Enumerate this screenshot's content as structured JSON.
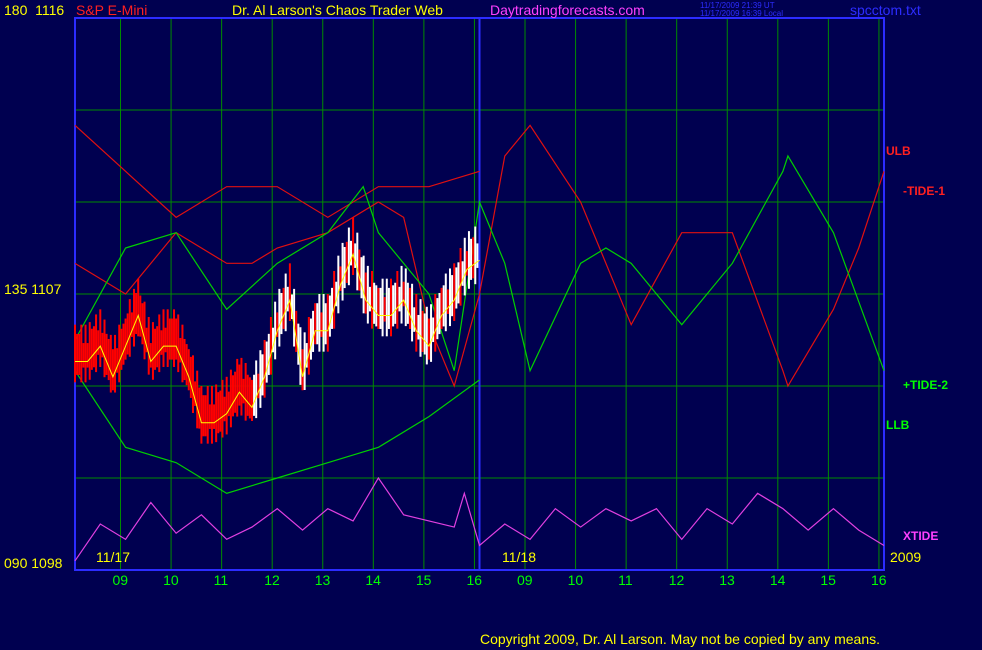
{
  "header": {
    "instrument": "S&P E-Mini",
    "title": "Dr. Al Larson's Chaos Trader Web",
    "site": "Daytradingforecasts.com",
    "timestamp_ut": "11/17/2009 21:39 UT",
    "timestamp_local": "11/17/2009 16:39 Local",
    "filename": "spcctom.txt"
  },
  "axis_left": {
    "top": "180  1116",
    "mid": "135  1107",
    "bottom": "090  1098"
  },
  "dates": {
    "day1": "11/17",
    "day2": "11/18",
    "year": "2009"
  },
  "legend": {
    "ulb": "ULB",
    "tide1": "-TIDE-1",
    "tide2": "+TIDE-2",
    "llb": "LLB",
    "xtide": "XTIDE"
  },
  "footer": {
    "copyright": "Copyright 2009, Dr. Al Larson. May not be copied by any means."
  },
  "colors": {
    "background": "#000050",
    "grid": "#008c00",
    "frame": "#2c2cff",
    "price_up": "#ffffff",
    "price_down": "#ff0000",
    "red_series": "#e01010",
    "green_series": "#00d000",
    "xtide": "#e040e0",
    "yellow": "#ffff00",
    "blue_avg": "#2020ff"
  },
  "chart_data": {
    "type": "line",
    "title": "",
    "ylim": [
      1098,
      1116
    ],
    "y_ticks": [
      1098,
      1107,
      1116
    ],
    "x_ticks": [
      "09",
      "10",
      "11",
      "12",
      "13",
      "14",
      "15",
      "16",
      "09",
      "10",
      "11",
      "12",
      "13",
      "14",
      "15",
      "16"
    ],
    "x_range": [
      0,
      16
    ],
    "series": [
      {
        "name": "ULB",
        "color": "#e01010",
        "x": [
          0,
          1,
          2,
          3,
          4,
          5,
          6,
          7,
          8
        ],
        "values": [
          1112.5,
          1111,
          1109.5,
          1110.5,
          1110.5,
          1109.5,
          1110.5,
          1110.5,
          1111
        ]
      },
      {
        "name": "LLB",
        "color": "#00d000",
        "x": [
          0,
          1,
          2,
          3,
          4,
          5,
          6,
          7,
          8
        ],
        "values": [
          1104.5,
          1102,
          1101.5,
          1100.5,
          1101,
          1101.5,
          1102,
          1103,
          1104.2
        ]
      },
      {
        "name": "-TIDE-1",
        "color": "#e01010",
        "x": [
          0,
          1,
          2,
          3,
          3.5,
          4,
          5,
          6,
          6.5,
          7,
          7.5,
          8,
          8.5,
          9,
          10,
          11,
          12,
          13,
          14,
          14.1,
          15,
          15.5,
          16
        ],
        "values": [
          1108,
          1107,
          1109,
          1108,
          1108,
          1108.5,
          1109,
          1110,
          1109.5,
          1106,
          1104,
          1107,
          1111.5,
          1112.5,
          1110,
          1106,
          1109,
          1109,
          1104.5,
          1104,
          1106.5,
          1108.5,
          1111
        ]
      },
      {
        "name": "+TIDE-2",
        "color": "#00d000",
        "x": [
          0,
          1,
          2,
          3,
          4,
          5,
          5.7,
          6,
          7,
          7.5,
          8,
          8.5,
          9,
          10,
          10.5,
          11,
          12,
          13,
          14,
          14.1,
          15,
          16
        ],
        "values": [
          1105.5,
          1108.5,
          1109,
          1106.5,
          1108,
          1109,
          1110.5,
          1109,
          1107,
          1104.5,
          1110,
          1108,
          1104.5,
          1108,
          1108.5,
          1108,
          1106,
          1108,
          1111,
          1111.5,
          1109,
          1104.5
        ]
      },
      {
        "name": "XTIDE",
        "color": "#e040e0",
        "x": [
          0,
          0.5,
          1,
          1.5,
          2,
          2.5,
          3,
          3.5,
          4,
          4.5,
          5,
          5.5,
          6,
          6.5,
          7,
          7.5,
          7.7,
          8,
          8.5,
          9,
          9.5,
          10,
          10.5,
          11,
          11.5,
          12,
          12.5,
          13,
          13.5,
          14,
          14.5,
          15,
          15.5,
          16
        ],
        "values": [
          1098.3,
          1099.5,
          1099,
          1100.2,
          1099.2,
          1099.8,
          1099,
          1099.4,
          1100,
          1099.3,
          1100,
          1099.6,
          1101,
          1099.8,
          1099.6,
          1099.4,
          1100.5,
          1098.8,
          1099.5,
          1099,
          1100,
          1099.4,
          1100,
          1099.6,
          1100,
          1099,
          1100,
          1099.5,
          1100.5,
          1100,
          1099.3,
          1100,
          1099.3,
          1098.8
        ]
      },
      {
        "name": "Price",
        "color": "#ffffff",
        "x": [
          0,
          0.25,
          0.5,
          0.75,
          1,
          1.25,
          1.5,
          1.75,
          2,
          2.25,
          2.5,
          2.75,
          3,
          3.25,
          3.5,
          3.75,
          4,
          4.25,
          4.5,
          4.75,
          5,
          5.25,
          5.5,
          5.75,
          6,
          6.25,
          6.5,
          6.75,
          7,
          7.25,
          7.5,
          7.75,
          8
        ],
        "values": [
          1105,
          1105,
          1105.5,
          1104.5,
          1105.5,
          1106.5,
          1105,
          1105.5,
          1105.5,
          1104.5,
          1103,
          1103,
          1103.3,
          1104,
          1103.5,
          1104.5,
          1106,
          1107,
          1104.5,
          1106,
          1106,
          1107.5,
          1108.5,
          1107,
          1106.5,
          1106.5,
          1107,
          1106,
          1105.5,
          1106.5,
          1107,
          1108,
          1108.3
        ]
      }
    ]
  }
}
